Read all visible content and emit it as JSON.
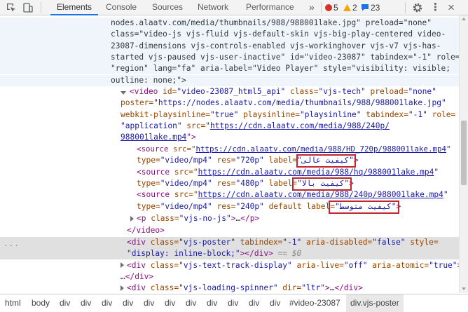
{
  "toolbar": {
    "tabs": [
      "Elements",
      "Console",
      "Sources",
      "Network",
      "Performance"
    ],
    "overflow_glyph": "»",
    "errors": "5",
    "warnings": "2",
    "messages": "23",
    "more_glyph": "⋮",
    "close_glyph": "×",
    "error_color": "#d93025",
    "warning_color": "#f2a600",
    "info_color": "#1a73e8"
  },
  "code": {
    "l1": "nodes.alaatv.com/media/thumbnails/988/988001lake.jpg\" preload=\"none\"",
    "l2": "class=\"video-js vjs-fluid vjs-default-skin vjs-big-play-centered video-",
    "l3": "23087-dimensions vjs-controls-enabled vjs-workinghover vjs-v7 vjs-has-",
    "l4": "started vjs-paused vjs-user-inactive\" id=\"video-23087\" tabindex=\"-1\" role=",
    "l5": "\"region\" lang=\"fa\" aria-label=\"Video Player\" style=\"visibility: visible;",
    "l6": "outline: none;\">",
    "video": {
      "a1": "<video",
      "a2": " id=",
      "a3": "\"video-23087_html5_api\"",
      "a4": " class=",
      "a5": "\"vjs-tech\"",
      "a6": " preload=",
      "a7": "\"none\"",
      "b1": "poster=",
      "b2": "\"https://nodes.alaatv.com/media/thumbnails/988/988001lake.jpg\"",
      "c1": "webkit-playsinline=",
      "c2": "\"true\"",
      "c3": " playsinline=",
      "c4": "\"playsinline\"",
      "c5": " tabindex=",
      "c6": "\"-1\"",
      "c7": " role=",
      "d1": "\"application\"",
      "d2": " src=",
      "d3": "\"",
      "d4": "https://cdn.alaatv.com/media/988/240p/",
      "e1": "988001lake.mp4",
      "e2": "\">"
    },
    "s1": {
      "open": "<source",
      "src_attr": " src=\"",
      "url": "https://cdn.alaatv.com/media/988/HD_720p/988001lake.mp4",
      "end": "\"",
      "type_attr": "type=",
      "type_val": "\"video/mp4\"",
      "res_attr": " res=",
      "res_val": "\"720p\"",
      "label_attr": " label=",
      "label_val": "\"کیفیت عالی\"",
      "close": ">"
    },
    "s2": {
      "open": "<source",
      "src_attr": " src=\"",
      "url": "https://cdn.alaatv.com/media/988/hq/988001lake.mp4",
      "end": "\"",
      "type_attr": "type=",
      "type_val": "\"video/mp4\"",
      "res_attr": " res=",
      "res_val": "\"480p\"",
      "label_attr": " label=",
      "label_val": "\"کیفیت بالا\"",
      "close": ">"
    },
    "s3": {
      "open": "<source",
      "src_attr": " src=\"",
      "url": "https://cdn.alaatv.com/media/988/240p/988001lake.mp4",
      "end": "\"",
      "type_attr": "type=",
      "type_val": "\"video/mp4\"",
      "res_attr": " res=",
      "res_val": "\"240p\"",
      "def_attr": " default",
      "label_attr": " label=",
      "label_val": "\"کیفیت متوسط\"",
      "close": ">"
    },
    "p": {
      "a": "<p",
      "b": " class=",
      "c": "\"vjs-no-js\"",
      "d": ">",
      "e": "…",
      "f": "</p>"
    },
    "video_close": "</video>",
    "poster": {
      "a": "<div",
      "b": " class=",
      "c": "\"vjs-poster\"",
      "d": " tabindex=",
      "e": "\"-1\"",
      "f": " aria-disabled=",
      "g": "\"false\"",
      "h": " style=",
      "i": "\"display: inline-block;\"",
      "j": "></div>",
      "k": " == $0"
    },
    "ttd": {
      "a": "<div",
      "b": " class=",
      "c": "\"vjs-text-track-display\"",
      "d": " aria-live=",
      "e": "\"off\"",
      "f": " aria-atomic=",
      "g": "\"true\"",
      "h": ">",
      "i": "…</div>"
    },
    "spin": {
      "a": "<div",
      "b": " class=",
      "c": "\"vjs-loading-spinner\"",
      "d": " dir=",
      "e": "\"ltr\"",
      "f": ">",
      "g": "…",
      "h": "</div>"
    },
    "dots": "..."
  },
  "breadcrumbs": [
    "html",
    "body",
    "div",
    "div",
    "div",
    "div",
    "div",
    "div",
    "div",
    "div",
    "div",
    "div",
    "div",
    "#video-23087",
    "div.vjs-poster"
  ]
}
